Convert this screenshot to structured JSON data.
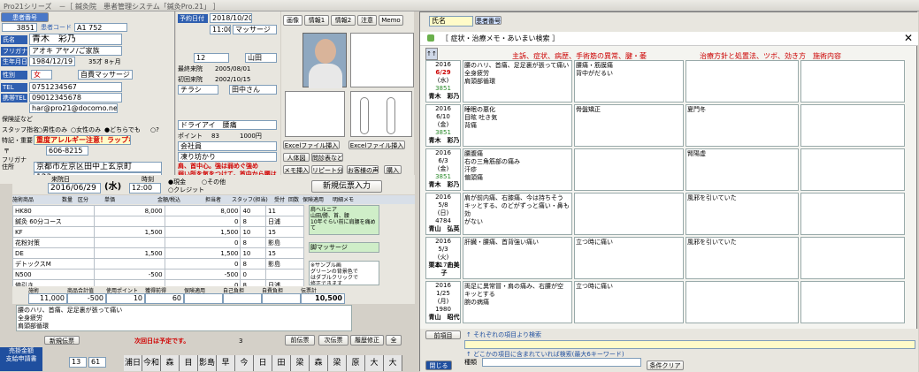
{
  "app_title": "Pro21シリーズ　－［ 鍼灸院　患者管理システム「鍼灸Pro.21」 ］",
  "patient": {
    "search_btn": "患者番号",
    "label_kanja_no": "患者番号",
    "kanja_no": "3851",
    "label_card": "患者コード",
    "card_code": "A1 752",
    "label_name": "氏名",
    "name": "青木　彩乃",
    "furigana_label": "フリガナ",
    "furigana": "アオキ アヤノ/ご家族",
    "birth_label": "生年月日",
    "birth": "1984/12/19",
    "age": "35",
    "age_unit": "才",
    "month": "8",
    "month_unit": "ヶ月",
    "sex_label": "性別",
    "sex": "女",
    "kind_label": "種別",
    "kind": "自費マッサージ",
    "tel_label": "TEL",
    "tel": "0751234567",
    "mobile_label": "携帯TEL",
    "mobile": "09012345678",
    "email_label": "E-mail",
    "email": "har@pro21@docomo.ne.jp",
    "allergy_label": "保険証など",
    "staff_label": "スタッフ指名",
    "staff_opts": [
      "○男性のみ",
      "○女性のみ",
      "●どちらでも",
      "○?"
    ],
    "special_label": "特記・重要",
    "special": "重度アレルギー注意！ラップなど",
    "zip_label": "〒",
    "zip": "606-8215",
    "furi_addr_label": "フリガナ\n住所",
    "address1": "京都市左京区田中上玄京町",
    "address2": "123"
  },
  "reserve": {
    "label": "予約日付",
    "date": "2018/10/20",
    "time": "11:00",
    "menu": "マッサージ",
    "staff_label": "スタッフ",
    "count": "12",
    "staff": "山田",
    "last_label": "最終来院",
    "last": "2005/08/01",
    "first_label": "初回来院",
    "first": "2002/10/15",
    "chirashi": "チラシ",
    "chirashi_staff": "田中さん",
    "kabu": "ドライアイ　腰痛",
    "point_label": "ポイント",
    "point": "83",
    "point_val": "1000",
    "point_unit": "円",
    "work_label": "職業",
    "work": "会社員",
    "hobby_label": "趣味・健康",
    "hobby": "凍り坊かり",
    "memo_label": "Memo",
    "memo1": "肩、首中心。強は弱めぐ強め",
    "memo2": "弱い所を気をつけて。首中から腰は強め強めで。"
  },
  "tabs": [
    "画像",
    "情報1",
    "情報2",
    "注意",
    "Memo"
  ],
  "image_btns": [
    "Excelファイル挿入",
    "Excelファイル挿入",
    "人体図",
    "問診表など",
    "メモ挿入",
    "リピート分析",
    "お客様の声",
    "購入"
  ],
  "visit": {
    "label": "来院日",
    "date": "2016/06/29",
    "weekday": "(水)",
    "time_label": "時刻",
    "time": "12:00",
    "pay_label": "",
    "pay1": "●現金",
    "pay2": "○クレジット",
    "pay3": "○その他",
    "new_btn": "新規伝票入力",
    "prev_btn": "前伝票",
    "next_btn": "次伝票",
    "history": "履歴修正",
    "all": "全"
  },
  "items_hdr": [
    "施術商品",
    "数量",
    "区分",
    "単価",
    "金額/税込",
    "担当者",
    "スタッフ(担当)",
    "受付",
    "回数",
    "保険適用",
    "明細メモ"
  ],
  "items": [
    {
      "name": "HK80",
      "price": "8,000",
      "amount": "8,000",
      "s1": "40",
      "s2": "11"
    },
    {
      "name": "鍼灸 60分コース",
      "price": "",
      "amount": "0",
      "s1": "8",
      "s2": "日浦"
    },
    {
      "name": "KF",
      "price": "1,500",
      "amount": "1,500",
      "s1": "10",
      "s2": "15"
    },
    {
      "name": "花粉対策",
      "price": "",
      "amount": "0",
      "s1": "8",
      "s2": "影島"
    },
    {
      "name": "DE",
      "price": "1,500",
      "amount": "1,500",
      "s1": "10",
      "s2": "15"
    },
    {
      "name": "デトックスM",
      "price": "",
      "amount": "0",
      "s1": "8",
      "s2": "影島"
    },
    {
      "name": "N500",
      "price": "-500",
      "amount": "-500",
      "s1": "0",
      "s2": ""
    },
    {
      "name": "値引き",
      "price": "",
      "amount": "0",
      "s1": "8",
      "s2": "日浦"
    }
  ],
  "memo_rows": [
    "肩ヘルニア\n山田/勝、首、腰\n10年ぐらい前に肩腰を痛めて",
    "脚マッサージ",
    "※サンプル画\nグリーンの背景色で\nはダブルクリックで\n修正できます"
  ],
  "totals_hdr": [
    "施術",
    "商品合計值",
    "使用ポイント",
    "獲得前得",
    "保険適用",
    "自己負担",
    "自費負担",
    "伝票計"
  ],
  "totals": [
    "11,000",
    "-500",
    "10",
    "60",
    "",
    "",
    "",
    "10,500"
  ],
  "notes": "腰のハリ、首痛、足足裏が張って痛い\n全身疲労\n肩頭部循環",
  "discount_label": "次回日は予定です。",
  "return_label": "新規伝票",
  "page_counter": "3",
  "bottom": {
    "label1": "売掛金額",
    "label2": "支給申請書",
    "cnt1": "13",
    "cnt2": "61"
  },
  "staff_bar": [
    "浦日",
    "今和日",
    "森",
    "目",
    "影島",
    "早",
    "今",
    "日",
    "田",
    "梁",
    "森",
    "梁",
    "原",
    "大",
    "大",
    "梁",
    "梁",
    "原",
    "町",
    "細",
    "今",
    "日",
    "日",
    "原",
    "梁",
    "森",
    "今"
  ],
  "history_win": {
    "title": "［ 症状・治療メモ・あいまい検索 ］",
    "subhdr_patient": "氏名",
    "subhdr_code": "患者番号",
    "cols": [
      "主訴、症状、病歴、手術歴",
      "筋の異常、腱・萎",
      "治療方針と処置法、ツボ、効き方",
      "施術内容"
    ],
    "rows": [
      {
        "y": "2016",
        "md": "6/29",
        "wd": "(水)",
        "no": "3851",
        "name": "青木　彩乃",
        "sym": "腰のハリ、首痛、足足裏が張って痛い\n全身疲労\n肩頭部循環",
        "mus": "腰痛・筋膜痛\n背中がだるい",
        "plan": "",
        "op": ""
      },
      {
        "y": "2016",
        "md": "6/10",
        "wd": "(金)",
        "no": "3851",
        "name": "青木　彩乃",
        "sym": "睡眠の悪化\n目眩 吐き気\n背痛",
        "mus": "骨盤矯正",
        "plan": "夏門冬",
        "op": ""
      },
      {
        "y": "2016",
        "md": "6/3",
        "wd": "(金)",
        "no": "3851",
        "name": "青木　彩乃",
        "sym": "腰腹痛\n右の三角筋部の痛み\n汗疹\n偏頭痛",
        "mus": "",
        "plan": "腎陽虚",
        "op": ""
      },
      {
        "y": "2016",
        "md": "5/8",
        "wd": "(日)",
        "no": "4784",
        "name": "青山　弘英",
        "sym": "肩が前内痛、右膝痛、今は持ちそう\nキッとする、のどがずっと痛い・鼻も効\nがない",
        "mus": "",
        "plan": "風邪を引いていた",
        "op": ""
      },
      {
        "y": "2016",
        "md": "5/3",
        "wd": "(火)",
        "no": "1177",
        "name": "栗本　由美子",
        "sym": "肝臓・腰痛、首背強い痛い",
        "mus": "立つ時に痛い",
        "plan": "風邪を引いていた",
        "op": ""
      },
      {
        "y": "2016",
        "md": "1/25",
        "wd": "(月)",
        "no": "1980",
        "name": "青山　昭代",
        "sym": "両足に異常冒・肩の痛み、右腰が空\nキッとする\n腕の病痛",
        "mus": "立つ時に痛い",
        "plan": "",
        "op": ""
      }
    ],
    "search1": "↑ それぞれの項目より検索",
    "search2": "↑ どこかの項目に含まれていれば検索(最大6キーワード)",
    "btn_close": "閉じる",
    "btn_clear": "条件クリア",
    "btn_other": "前項目",
    "btn_kind": "種類"
  }
}
